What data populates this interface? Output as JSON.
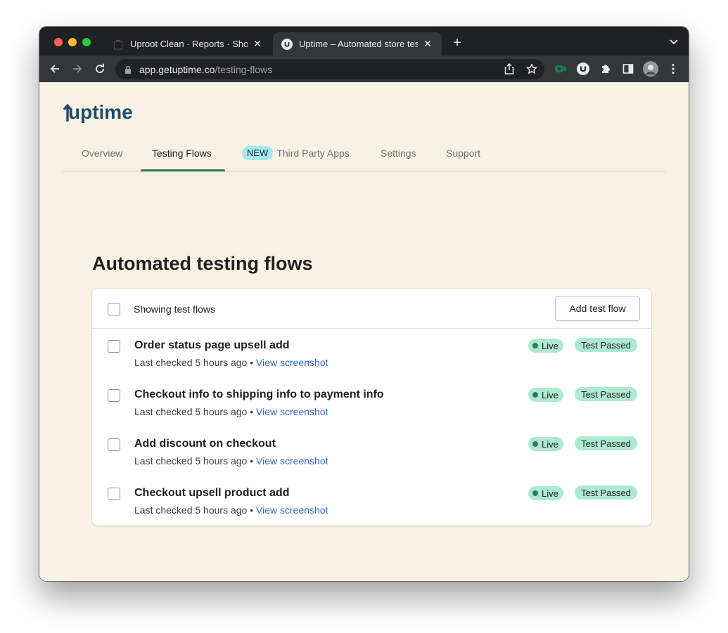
{
  "browser": {
    "tabs": [
      {
        "title": "Uproot Clean · Reports · Shopify",
        "active": false
      },
      {
        "title": "Uptime – Automated store testing",
        "active": true
      }
    ],
    "url_host": "app.getuptime.co",
    "url_path": "/testing-flows",
    "profile_initial": ""
  },
  "app": {
    "logo_text": "uptime",
    "nav": {
      "items": [
        {
          "label": "Overview"
        },
        {
          "label": "Testing Flows",
          "active": true
        },
        {
          "label": "Third Party Apps",
          "badge": "NEW"
        },
        {
          "label": "Settings"
        },
        {
          "label": "Support"
        }
      ]
    },
    "heading": "Automated testing flows",
    "card": {
      "showing_label": "Showing test flows",
      "add_button": "Add test flow"
    },
    "flows": [
      {
        "title": "Order status page upsell add",
        "checked": "Last checked 5 hours ago",
        "separator": "•",
        "link": "View screenshot",
        "status": "Live",
        "result": "Test Passed"
      },
      {
        "title": "Checkout info to shipping info to payment info",
        "checked": "Last checked 5 hours ago",
        "separator": "•",
        "link": "View screenshot",
        "status": "Live",
        "result": "Test Passed"
      },
      {
        "title": "Add discount on checkout",
        "checked": "Last checked 5 hours ago",
        "separator": "•",
        "link": "View screenshot",
        "status": "Live",
        "result": "Test Passed"
      },
      {
        "title": "Checkout upsell product add",
        "checked": "Last checked 5 hours ago",
        "separator": "•",
        "link": "View screenshot",
        "status": "Live",
        "result": "Test Passed"
      }
    ]
  },
  "colors": {
    "page_bg": "#f7f2e3",
    "brand": "#1e4a6d",
    "nav_active": "#2e7d57",
    "badge_green": "#aee9d1",
    "new_badge": "#a4e8f2",
    "link": "#2c6ecb"
  }
}
